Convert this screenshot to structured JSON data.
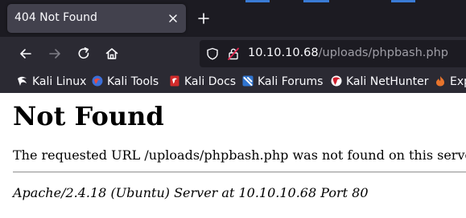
{
  "tab": {
    "title": "404 Not Found"
  },
  "urlbar": {
    "host": "10.10.10.68",
    "path": "/uploads/phpbash.php"
  },
  "bookmarks": [
    {
      "label": "Kali Linux",
      "icon": "kali-dragon-icon"
    },
    {
      "label": "Kali Tools",
      "icon": "kali-tools-icon"
    },
    {
      "label": "Kali Docs",
      "icon": "kali-docs-icon"
    },
    {
      "label": "Kali Forums",
      "icon": "kali-forums-icon"
    },
    {
      "label": "Kali NetHunter",
      "icon": "kali-nethunter-icon"
    },
    {
      "label": "Exp",
      "icon": "exploit-db-icon"
    }
  ],
  "page": {
    "heading": "Not Found",
    "message": "The requested URL /uploads/phpbash.php was not found on this serve",
    "address": "Apache/2.4.18 (Ubuntu) Server at 10.10.10.68 Port 80"
  },
  "colors": {
    "chrome_dark": "#1c1b22",
    "toolbar": "#2b2a33",
    "tab_active": "#42414d",
    "accent_blue": "#3a7bd5"
  }
}
